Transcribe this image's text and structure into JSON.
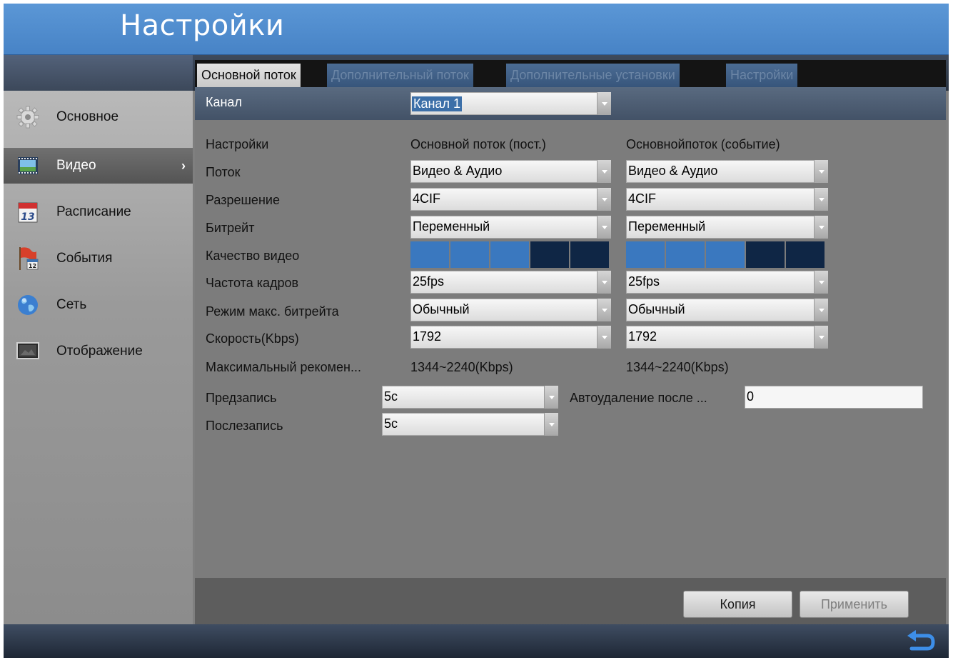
{
  "header": {
    "title": "Настройки"
  },
  "sidebar": {
    "items": [
      {
        "label": "Основное",
        "icon": "gear-icon",
        "active": false
      },
      {
        "label": "Видео",
        "icon": "film-icon",
        "active": true
      },
      {
        "label": "Расписание",
        "icon": "calendar-icon",
        "active": false,
        "icon_text": "13"
      },
      {
        "label": "События",
        "icon": "event-flag-icon",
        "active": false,
        "icon_text": "12"
      },
      {
        "label": "Сеть",
        "icon": "globe-icon",
        "active": false
      },
      {
        "label": "Отображение",
        "icon": "monitor-icon",
        "active": false
      }
    ],
    "chevron": "›"
  },
  "tabs": [
    {
      "label": "Основной поток",
      "active": true
    },
    {
      "label": "Дополнительный поток",
      "active": false
    },
    {
      "label": "Дополнительные установки",
      "active": false
    },
    {
      "label": "Настройки",
      "active": false
    }
  ],
  "channel": {
    "label": "Канал",
    "value": "Канал 1"
  },
  "columns": {
    "settings": "Настройки",
    "main_const": "Основной поток (пост.)",
    "main_event": "Основнойпоток (событие)"
  },
  "rows": {
    "stream": {
      "label": "Поток",
      "const": "Видео & Аудио",
      "event": "Видео & Аудио"
    },
    "resolution": {
      "label": "Разрешение",
      "const": "4CIF",
      "event": "4CIF"
    },
    "bitrate": {
      "label": "Битрейт",
      "const": "Переменный",
      "event": "Переменный"
    },
    "quality": {
      "label": "Качество видео",
      "const_level": 3,
      "event_level": 3,
      "max_level": 5
    },
    "framerate": {
      "label": "Частота кадров",
      "const": "25fps",
      "event": "25fps"
    },
    "maxmode": {
      "label": "Режим макс. битрейта",
      "const": "Обычный",
      "event": "Обычный"
    },
    "speed": {
      "label": "Скорость(Kbps)",
      "const": "1792",
      "event": "1792"
    },
    "recommended": {
      "label": "Максимальный рекомен...",
      "const": "1344~2240(Kbps)",
      "event": "1344~2240(Kbps)"
    }
  },
  "prerecord": {
    "label": "Предзапись",
    "value": "5с"
  },
  "postrecord": {
    "label": "Послезапись",
    "value": "5с"
  },
  "autodelete": {
    "label": "Автоудаление после ...",
    "value": "0"
  },
  "buttons": {
    "copy": "Копия",
    "apply": "Применить"
  },
  "colors": {
    "header": "#4f8dd0",
    "quality_filled": "#3a78bf",
    "quality_empty": "#0f2645",
    "active_tab": "#d6d6d6"
  }
}
